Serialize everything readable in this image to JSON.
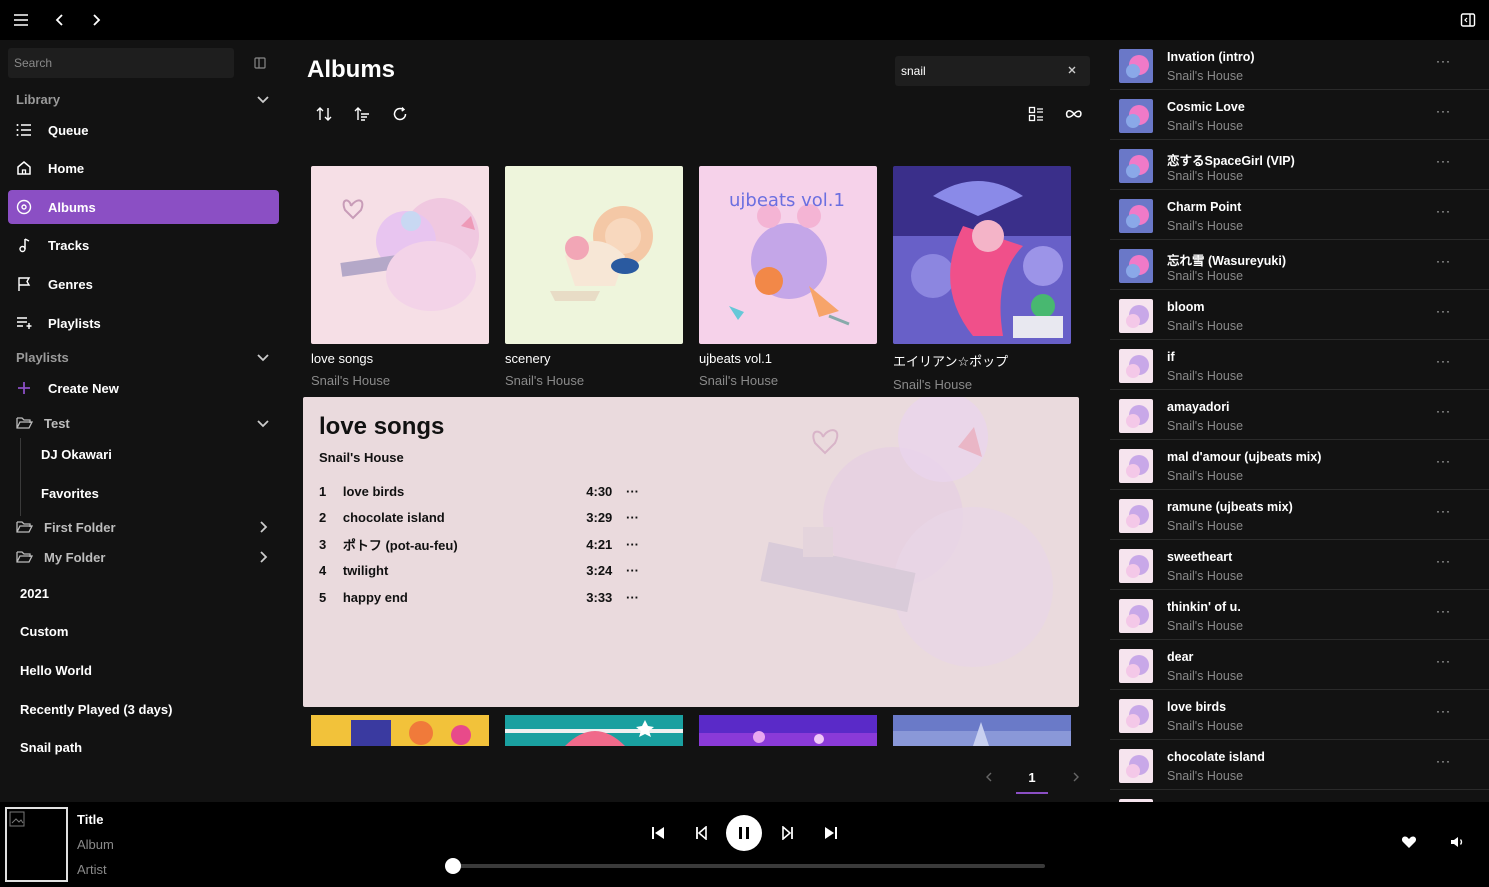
{
  "sidebar": {
    "search_placeholder": "Search",
    "library_label": "Library",
    "nav": [
      {
        "label": "Queue",
        "icon": "list-icon"
      },
      {
        "label": "Home",
        "icon": "home-icon"
      },
      {
        "label": "Albums",
        "icon": "album-icon"
      },
      {
        "label": "Tracks",
        "icon": "music-note-icon"
      },
      {
        "label": "Genres",
        "icon": "flag-icon"
      },
      {
        "label": "Playlists",
        "icon": "playlist-icon"
      }
    ],
    "playlists_label": "Playlists",
    "create_new": "Create New",
    "folder_test": "Test",
    "test_children": [
      "DJ Okawari",
      "Favorites"
    ],
    "folders": [
      "First Folder",
      "My Folder"
    ],
    "playlists": [
      "2021",
      "Custom",
      "Hello World",
      "Recently Played (3 days)",
      "Snail path"
    ]
  },
  "main": {
    "title": "Albums",
    "search_value": "snail",
    "albums": [
      {
        "title": "love songs",
        "artist": "Snail's House"
      },
      {
        "title": "scenery",
        "artist": "Snail's House"
      },
      {
        "title": "ujbeats vol.1",
        "artist": "Snail's House"
      },
      {
        "title": "エイリアン☆ポップ",
        "artist": "Snail's House"
      }
    ],
    "detail": {
      "title": "love songs",
      "artist": "Snail's House",
      "tracks": [
        {
          "n": "1",
          "title": "love birds",
          "dur": "4:30"
        },
        {
          "n": "2",
          "title": "chocolate island",
          "dur": "3:29"
        },
        {
          "n": "3",
          "title": "ポトフ (pot-au-feu)",
          "dur": "4:21"
        },
        {
          "n": "4",
          "title": "twilight",
          "dur": "3:24"
        },
        {
          "n": "5",
          "title": "happy end",
          "dur": "3:33"
        }
      ]
    },
    "page": "1"
  },
  "queue": [
    {
      "title": "Invation (intro)",
      "artist": "Snail's House"
    },
    {
      "title": "Cosmic Love",
      "artist": "Snail's House"
    },
    {
      "title": "恋するSpaceGirl (VIP)",
      "artist": "Snail's House"
    },
    {
      "title": "Charm Point",
      "artist": "Snail's House"
    },
    {
      "title": "忘れ雪 (Wasureyuki)",
      "artist": "Snail's House"
    },
    {
      "title": "bloom",
      "artist": "Snail's House"
    },
    {
      "title": "if",
      "artist": "Snail's House"
    },
    {
      "title": "amayadori",
      "artist": "Snail's House"
    },
    {
      "title": "mal d'amour (ujbeats mix)",
      "artist": "Snail's House"
    },
    {
      "title": "ramune (ujbeats mix)",
      "artist": "Snail's House"
    },
    {
      "title": "sweetheart",
      "artist": "Snail's House"
    },
    {
      "title": "thinkin' of u.",
      "artist": "Snail's House"
    },
    {
      "title": "dear",
      "artist": "Snail's House"
    },
    {
      "title": "love birds",
      "artist": "Snail's House"
    },
    {
      "title": "chocolate island",
      "artist": "Snail's House"
    }
  ],
  "player": {
    "title": "Title",
    "album": "Album",
    "artist": "Artist",
    "progress": 0
  },
  "more_glyph": "···",
  "colors": {
    "accent": "#8b4fc4",
    "bg": "#121212"
  }
}
